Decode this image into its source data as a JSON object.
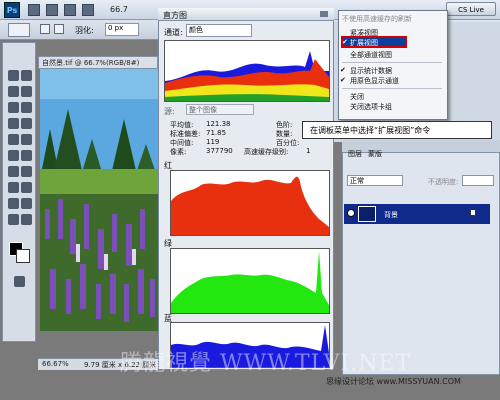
{
  "app": {
    "logo_text": "Ps",
    "zoom_menu": "66.7",
    "cs_button": "CS Live"
  },
  "options_bar": {
    "feather_label": "羽化:",
    "feather_value": "0 px"
  },
  "document": {
    "title": "自然景.tif @ 66.7%(RGB/8#)",
    "zoom": "66.67%",
    "size": "9.79 厘米 x 6.22 厘米"
  },
  "histogram_panel": {
    "title": "直方图",
    "channel_label": "通道:",
    "channel_value": "颜色",
    "source_label": "源:",
    "source_value": "整个图像",
    "stats": {
      "mean_label": "平均值:",
      "mean": "121.38",
      "std_label": "标准偏差:",
      "std": "71.85",
      "median_label": "中间值:",
      "median": "119",
      "pixels_label": "像素:",
      "pixels": "377790",
      "level_label": "色阶:",
      "count_label": "数量:",
      "percentile_label": "百分位:",
      "cache_label": "高速缓存级别:",
      "cache": "1"
    },
    "red_label": "红",
    "green_label": "绿",
    "blue_label": "蓝"
  },
  "flyout_menu": {
    "item_uncached": "不使用高速缓存的刷新",
    "item_compact": "紧凑视图",
    "item_expanded": "扩展视图",
    "item_all_channels": "全部通道视图",
    "item_show_stats": "显示统计数据",
    "item_color_channels": "用原色显示通道",
    "item_close": "关闭",
    "item_close_group": "关闭选项卡组"
  },
  "layers_panel": {
    "tab_channels": "图层",
    "tab_layers": "蒙版",
    "blend_mode": "正常",
    "opacity_label": "不透明度:",
    "layer_name": "背景"
  },
  "callout": {
    "text": "在调板菜单中选择“扩展视图”命令"
  },
  "watermarks": {
    "main": "腾龍視覺 WWW.TLVI.NET",
    "site": "思缘设计论坛 www.MISSYUAN.COM"
  },
  "colors": {
    "red_hist": "#e8300f",
    "green_hist": "#22e80f",
    "blue_hist": "#1a1adf",
    "highlight": "#0b3f9e",
    "outline": "#d40000"
  }
}
